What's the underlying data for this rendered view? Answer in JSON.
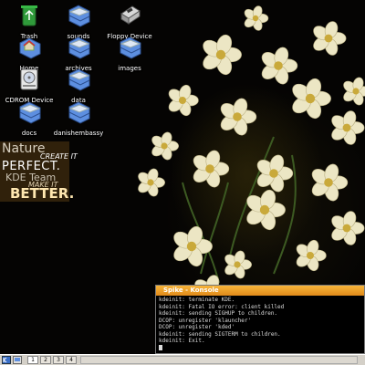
{
  "desktop_icons": [
    {
      "label": "Trash",
      "icon": "trash-icon"
    },
    {
      "label": "sounds",
      "icon": "folder-icon"
    },
    {
      "label": "Floppy Device",
      "icon": "floppy-icon"
    },
    {
      "label": "Home",
      "icon": "home-folder-icon"
    },
    {
      "label": "archives",
      "icon": "folder-icon"
    },
    {
      "label": "images",
      "icon": "folder-icon"
    },
    {
      "label": "CDROM Device",
      "icon": "cdrom-icon"
    },
    {
      "label": "data",
      "icon": "folder-icon"
    },
    {
      "label": "docs",
      "icon": "folder-icon"
    },
    {
      "label": "danishembassy",
      "icon": "folder-icon"
    }
  ],
  "wallpaper_badge": {
    "line1": "Nature",
    "line2": "CREATE IT",
    "line3": "PERFECT.",
    "line4": "KDE Team",
    "line5": "MAKE IT",
    "line6": "BETTER."
  },
  "konsole": {
    "title": "Spike - Konsole",
    "lines": [
      "kdeinit: terminate KDE.",
      "kdeinit: Fatal IO error: client killed",
      "kdeinit: sending SIGHUP to children.",
      "DCOP: unregister 'klauncher'",
      "DCOP: unregister 'kded'",
      "kdeinit: sending SIGTERM to children.",
      "kdeinit: Exit."
    ]
  },
  "taskbar": {
    "pager": [
      "1",
      "2",
      "3",
      "4"
    ],
    "active_desktop": "1"
  },
  "colors": {
    "titlebar": "#f0a030",
    "folder_blue": "#4a7fd0",
    "taskbar": "#d4d0c8"
  }
}
